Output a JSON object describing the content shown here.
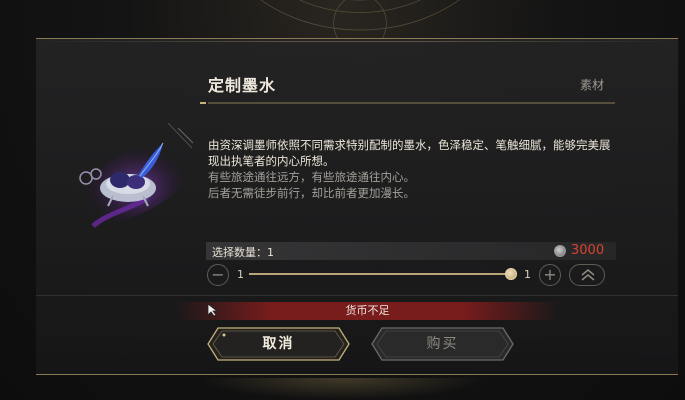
{
  "item": {
    "name": "定制墨水",
    "category": "素材",
    "description": "由资深调墨师依照不同需求特别配制的墨水，色泽稳定、笔触细腻，能够完美展现出执笔者的内心所想。",
    "flavor_1": "有些旅途通往远方，有些旅途通往内心。",
    "flavor_2": "后者无需徒步前行，却比前者更加漫长。"
  },
  "purchase": {
    "quantity_label": "选择数量：1",
    "price": "3000",
    "price_color": "#d6442f",
    "slider_min": "1",
    "slider_max": "1",
    "slider_fraction": 1.0
  },
  "warning": {
    "text": "货币不足",
    "color": "#7d1c1c"
  },
  "buttons": {
    "cancel": "取消",
    "buy": "购买"
  },
  "icons": {
    "minus": "minus-icon",
    "plus": "plus-icon",
    "max": "double-chevron-up-icon",
    "currency": "currency-coin-icon",
    "cursor": "mouse-cursor-icon"
  },
  "colors": {
    "accent_gold": "#b9a57c",
    "panel_border": "#8c7a55"
  }
}
